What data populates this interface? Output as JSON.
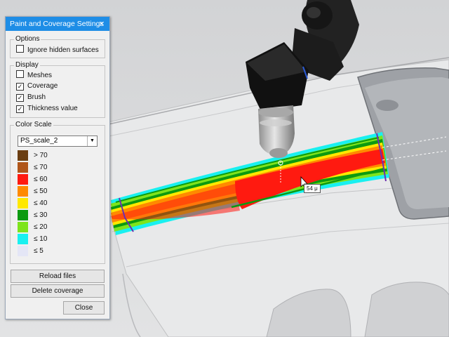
{
  "panel": {
    "title": "Paint and Coverage Settings",
    "close_glyph": "×",
    "options": {
      "legend": "Options",
      "ignore_hidden": {
        "label": "Ignore hidden surfaces",
        "checked": false
      }
    },
    "display": {
      "legend": "Display",
      "items": [
        {
          "label": "Meshes",
          "checked": false
        },
        {
          "label": "Coverage",
          "checked": true
        },
        {
          "label": "Brush",
          "checked": true
        },
        {
          "label": "Thickness value",
          "checked": true
        }
      ]
    },
    "color_scale": {
      "legend": "Color Scale",
      "selected": "PS_scale_2",
      "levels": [
        {
          "label": "> 70",
          "color": "#6b3e12"
        },
        {
          "label": "≤ 70",
          "color": "#b0561a"
        },
        {
          "label": "≤ 60",
          "color": "#ff1a10"
        },
        {
          "label": "≤ 50",
          "color": "#ff8a00"
        },
        {
          "label": "≤ 40",
          "color": "#ffe800"
        },
        {
          "label": "≤ 30",
          "color": "#0c9a10"
        },
        {
          "label": "≤ 20",
          "color": "#7ee41c"
        },
        {
          "label": "≤ 10",
          "color": "#19f0f0"
        },
        {
          "label": "≤ 5",
          "color": "#e4e6f6"
        }
      ]
    },
    "buttons": {
      "reload": "Reload files",
      "delete": "Delete coverage",
      "close": "Close"
    }
  },
  "viewport": {
    "thickness_readout": "54 μ"
  },
  "colors": {
    "title_bar": "#1e8de6",
    "panel_bg": "#f0f0f0",
    "robot": "#1a1a1a",
    "nozzle": "#bdbdbd"
  },
  "icons": [
    "close-icon",
    "chevron-down-icon",
    "checkmark-icon",
    "cursor-arrow-icon"
  ]
}
